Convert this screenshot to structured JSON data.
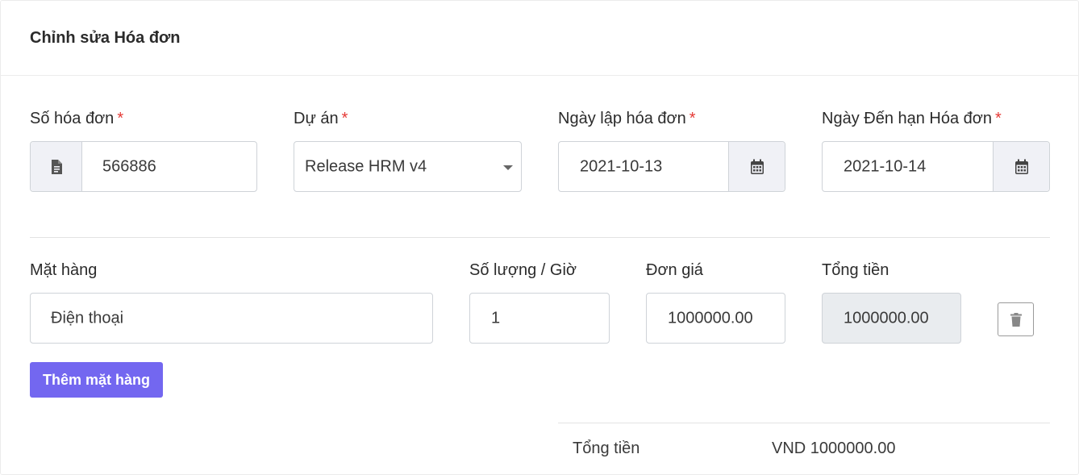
{
  "card": {
    "title": "Chỉnh sửa Hóa đơn"
  },
  "required_mark": "*",
  "invoice": {
    "number_label": "Số hóa đơn",
    "number_value": "566886",
    "project_label": "Dự án",
    "project_value": "Release HRM v4",
    "issue_date_label": "Ngày lập hóa đơn",
    "issue_date_value": "2021-10-13",
    "due_date_label": "Ngày Đến hạn Hóa đơn",
    "due_date_value": "2021-10-14"
  },
  "items": {
    "headers": {
      "item": "Mặt hàng",
      "quantity": "Số lượng / Giờ",
      "unit_price": "Đơn giá",
      "total": "Tổng tiền"
    },
    "rows": [
      {
        "item": "Điện thoại",
        "quantity": "1",
        "unit_price": "1000000.00",
        "total": "1000000.00"
      }
    ],
    "add_button_label": "Thêm mặt hàng"
  },
  "summary": {
    "total_label": "Tổng tiền",
    "total_value": "VND 1000000.00"
  },
  "icons": {
    "number_addon": "document-icon",
    "date_addon": "calendar-icon",
    "delete": "trash-icon",
    "select": "chevron-down-icon"
  },
  "colors": {
    "primary": "#7367f0",
    "required": "#e53935",
    "addon_bg": "#f0f1f6",
    "readonly_bg": "#e9ecef"
  }
}
